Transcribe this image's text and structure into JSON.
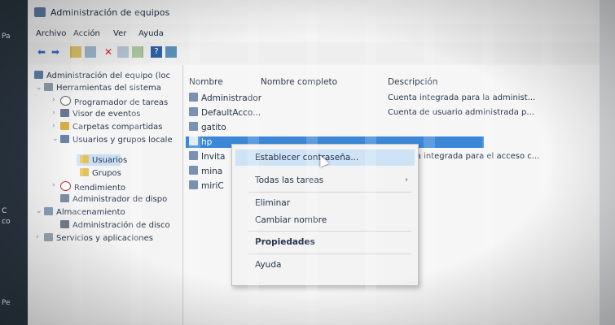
{
  "desktop": {
    "labels": [
      "Pa",
      "C",
      "co",
      "Pe"
    ]
  },
  "window": {
    "title": "Administración de equipos"
  },
  "menu": [
    "Archivo",
    "Acción",
    "Ver",
    "Ayuda"
  ],
  "toolbar": {
    "icons": [
      "back-arrow-icon",
      "forward-arrow-icon",
      "up-folder-icon",
      "show-tree-icon",
      "delete-icon",
      "properties-icon",
      "export-icon",
      "help-icon",
      "view-icon"
    ]
  },
  "tree": {
    "root": "Administración del equipo (loc",
    "system_tools": "Herramientas del sistema",
    "task_scheduler": "Programador de tareas",
    "event_viewer": "Visor de eventos",
    "shared_folders": "Carpetas compartidas",
    "users_groups": "Usuarios y grupos locale",
    "users": "Usuarios",
    "groups": "Grupos",
    "performance": "Rendimiento",
    "device_manager": "Administrador de dispo",
    "storage": "Almacenamiento",
    "disk_manager": "Administración de disco",
    "services": "Servicios y aplicaciones"
  },
  "list": {
    "headers": {
      "name": "Nombre",
      "fullname": "Nombre completo",
      "description": "Descripción"
    },
    "rows": [
      {
        "name": "Administrador",
        "desc": "Cuenta integrada para la administ..."
      },
      {
        "name": "DefaultAcco...",
        "desc": "Cuenta de usuario administrada p..."
      },
      {
        "name": "gatito",
        "desc": ""
      },
      {
        "name": "hp",
        "desc": ""
      },
      {
        "name": "Invita",
        "desc": "uenta integrada para el acceso c..."
      },
      {
        "name": "mina",
        "desc": ""
      },
      {
        "name": "miriC",
        "desc": ""
      }
    ]
  },
  "context_menu": {
    "set_password": "Establecer contraseña...",
    "all_tasks": "Todas las tareas",
    "delete": "Eliminar",
    "rename": "Cambiar nombre",
    "properties": "Propiedades",
    "help": "Ayuda"
  },
  "colors": {
    "selection": "#3b88d8",
    "hover": "#cfe3f6",
    "tree_selected": "#c9dff4"
  }
}
